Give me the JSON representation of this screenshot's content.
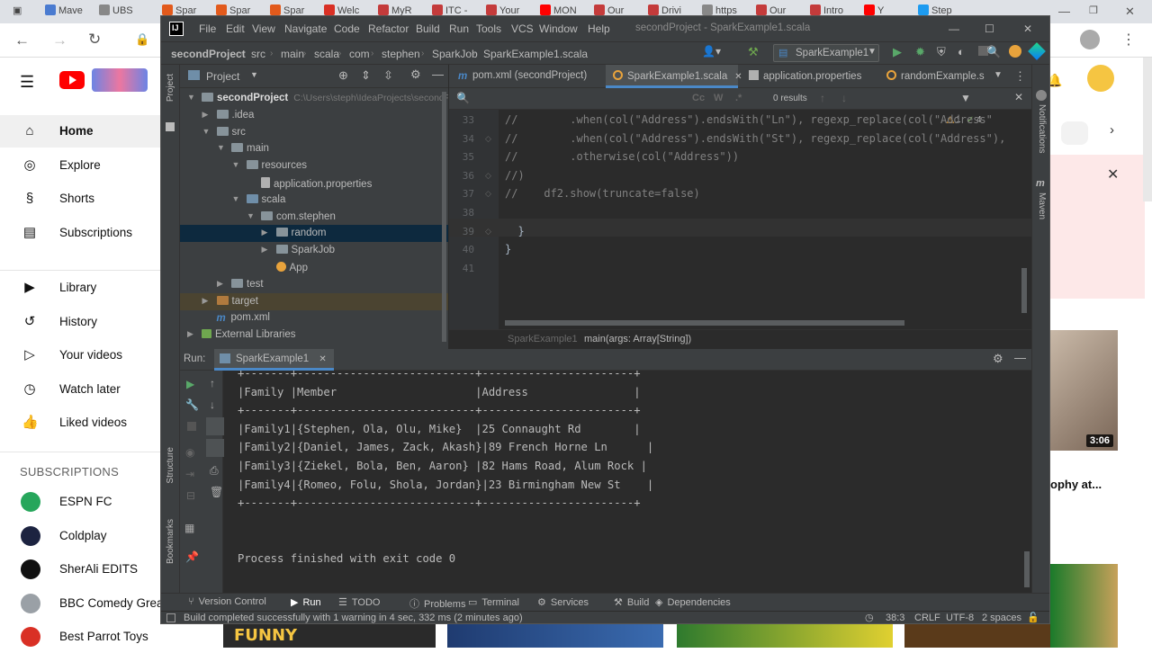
{
  "browser": {
    "tabs": [
      {
        "label": "Mave",
        "color": "#4a7bd0"
      },
      {
        "label": "UBS",
        "color": "#888888"
      },
      {
        "label": "Spar",
        "color": "#e25a1c"
      },
      {
        "label": "Spar",
        "color": "#e25a1c"
      },
      {
        "label": "Spar",
        "color": "#e25a1c"
      },
      {
        "label": "Welc",
        "color": "#d93025"
      },
      {
        "label": "MyR",
        "color": "#c43b3b"
      },
      {
        "label": "ITC -",
        "color": "#c43b3b"
      },
      {
        "label": "Your",
        "color": "#c43b3b"
      },
      {
        "label": "MON",
        "color": "#ff0000"
      },
      {
        "label": "Our",
        "color": "#c43b3b"
      },
      {
        "label": "Drivi",
        "color": "#c43b3b"
      },
      {
        "label": "https",
        "color": "#888888"
      },
      {
        "label": "Our",
        "color": "#c43b3b"
      },
      {
        "label": "Intro",
        "color": "#c43b3b"
      },
      {
        "label": "Y",
        "color": "#ff0000"
      },
      {
        "label": "Step",
        "color": "#1d9bf0"
      }
    ]
  },
  "youtube": {
    "nav": [
      {
        "label": "Home",
        "icon": "⌂"
      },
      {
        "label": "Explore",
        "icon": "◎"
      },
      {
        "label": "Shorts",
        "icon": "§"
      },
      {
        "label": "Subscriptions",
        "icon": "▤"
      }
    ],
    "library": [
      {
        "label": "Library",
        "icon": "▶"
      },
      {
        "label": "History",
        "icon": "↺"
      },
      {
        "label": "Your videos",
        "icon": "▷"
      },
      {
        "label": "Watch later",
        "icon": "◷"
      },
      {
        "label": "Liked videos",
        "icon": "👍"
      }
    ],
    "subscriptions_title": "SUBSCRIPTIONS",
    "subscriptions": [
      {
        "label": "ESPN FC",
        "color": "#26a65b"
      },
      {
        "label": "Coldplay",
        "color": "#1c2340"
      },
      {
        "label": "SherAli EDITS",
        "color": "#111111"
      },
      {
        "label": "BBC Comedy Great",
        "color": "#9aa0a6"
      },
      {
        "label": "Best Parrot Toys",
        "color": "#d93025"
      }
    ],
    "video_duration": "3:06",
    "video_title_fragment": "ophy at...",
    "thumb_text": "FUNNY"
  },
  "ide": {
    "title": "secondProject - SparkExample1.scala",
    "menu": [
      "File",
      "Edit",
      "View",
      "Navigate",
      "Code",
      "Refactor",
      "Build",
      "Run",
      "Tools",
      "VCS",
      "Window",
      "Help"
    ],
    "breadcrumb": [
      "secondProject",
      "src",
      "main",
      "scala",
      "com",
      "stephen",
      "SparkJob",
      "SparkExample1.scala"
    ],
    "run_config": "SparkExample1",
    "project_panel_title": "Project",
    "tree": [
      {
        "label": "secondProject",
        "extra": "C:\\Users\\steph\\IdeaProjects\\secondP",
        "depth": 0,
        "open": true,
        "kind": "folder"
      },
      {
        "label": ".idea",
        "depth": 1,
        "open": false,
        "kind": "folder"
      },
      {
        "label": "src",
        "depth": 1,
        "open": true,
        "kind": "folder"
      },
      {
        "label": "main",
        "depth": 2,
        "open": true,
        "kind": "folder"
      },
      {
        "label": "resources",
        "depth": 3,
        "open": true,
        "kind": "folder"
      },
      {
        "label": "application.properties",
        "depth": 4,
        "kind": "file"
      },
      {
        "label": "scala",
        "depth": 3,
        "open": true,
        "kind": "folder-blue"
      },
      {
        "label": "com.stephen",
        "depth": 4,
        "open": true,
        "kind": "folder"
      },
      {
        "label": "random",
        "depth": 5,
        "open": false,
        "kind": "folder",
        "selected": true
      },
      {
        "label": "SparkJob",
        "depth": 5,
        "open": false,
        "kind": "folder"
      },
      {
        "label": "App",
        "depth": 5,
        "kind": "object"
      },
      {
        "label": "test",
        "depth": 2,
        "open": false,
        "kind": "folder"
      },
      {
        "label": "target",
        "depth": 1,
        "open": false,
        "kind": "folder-orange",
        "highlight": true
      },
      {
        "label": "pom.xml",
        "depth": 1,
        "kind": "maven"
      },
      {
        "label": "External Libraries",
        "depth": 0,
        "open": false,
        "kind": "lib"
      }
    ],
    "editor_tabs": [
      {
        "label": "pom.xml (secondProject)",
        "active": false
      },
      {
        "label": "SparkExample1.scala",
        "active": true
      },
      {
        "label": "application.properties",
        "active": false
      },
      {
        "label": "randomExample.s",
        "active": false
      }
    ],
    "search_results": "0 results",
    "inspections": {
      "warnings": "1",
      "weak": "4"
    },
    "code_lines": [
      {
        "n": "33",
        "text": "//        .when(col(\"Address\").endsWith(\"Ln\"), regexp_replace(col(\"Address\"",
        "comment": true
      },
      {
        "n": "34",
        "text": "//        .when(col(\"Address\").endsWith(\"St\"), regexp_replace(col(\"Address\"),",
        "comment": true
      },
      {
        "n": "35",
        "text": "//        .otherwise(col(\"Address\"))",
        "comment": true
      },
      {
        "n": "36",
        "text": "//)",
        "comment": true
      },
      {
        "n": "37",
        "text": "//    df2.show(truncate=false)",
        "comment": true
      },
      {
        "n": "38",
        "text": "",
        "comment": false
      },
      {
        "n": "39",
        "text": "  }",
        "comment": false
      },
      {
        "n": "40",
        "text": "}",
        "comment": false
      },
      {
        "n": "41",
        "text": "",
        "comment": false
      }
    ],
    "editor_crumbs": [
      "SparkExample1",
      "main(args: Array[String])"
    ],
    "run_label": "Run:",
    "run_tab": "SparkExample1",
    "console_lines": [
      "+-------+---------------------------+-----------------------+",
      "|Family |Member                     |Address                |",
      "+-------+---------------------------+-----------------------+",
      "|Family1|{Stephen, Ola, Olu, Mike}  |25 Connaught Rd        |",
      "|Family2|{Daniel, James, Zack, Akash}|89 French Horne Ln      |",
      "|Family3|{Ziekel, Bola, Ben, Aaron} |82 Hams Road, Alum Rock |",
      "|Family4|{Romeo, Folu, Shola, Jordan}|23 Birmingham New St    |",
      "+-------+---------------------------+-----------------------+",
      "",
      "",
      "Process finished with exit code 0"
    ],
    "bottom_tools": [
      "Version Control",
      "Run",
      "TODO",
      "Problems",
      "Terminal",
      "Services",
      "Build",
      "Dependencies"
    ],
    "status_message": "Build completed successfully with 1 warning in 4 sec, 332 ms (2 minutes ago)",
    "status_right": [
      "38:3",
      "CRLF",
      "UTF-8",
      "2 spaces"
    ],
    "side_labels": {
      "project": "Project",
      "structure": "Structure",
      "bookmarks": "Bookmarks",
      "notifications": "Notifications",
      "maven": "Maven"
    }
  }
}
